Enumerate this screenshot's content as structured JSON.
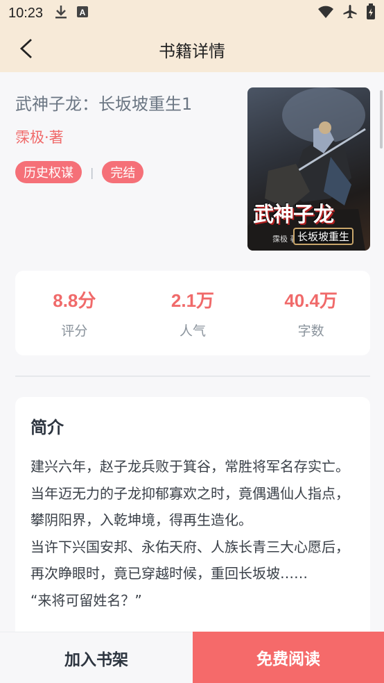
{
  "status_bar": {
    "time": "10:23",
    "icons": [
      "download-icon",
      "a-icon",
      "wifi-icon",
      "airplane-icon",
      "battery-icon"
    ]
  },
  "nav": {
    "title": "书籍详情"
  },
  "book": {
    "title": "武神子龙：长坂坡重生1",
    "author": "霂极·著",
    "tags": [
      "历史权谋",
      "完结"
    ],
    "tag_separator": "|",
    "cover": {
      "title_text": "武神子龙",
      "subtitle_text": "长坂坡重生",
      "author_text": "霂极 著"
    }
  },
  "stats": [
    {
      "value": "8.8分",
      "label": "评分"
    },
    {
      "value": "2.1万",
      "label": "人气"
    },
    {
      "value": "40.4万",
      "label": "字数"
    }
  ],
  "intro": {
    "heading": "简介",
    "text": "建兴六年，赵子龙兵败于箕谷，常胜将军名存实亡。\n当年迈无力的子龙抑郁寡欢之时，竟偶遇仙人指点，攀阴阳界，入乾坤境，得再生造化。\n当许下兴国安邦、永佑天府、人族长青三大心愿后，再次睁眼时，竟已穿越时候，重回长坂坡……\n“来将可留姓名？”"
  },
  "bottom": {
    "add_shelf": "加入书架",
    "read_free": "免费阅读"
  },
  "colors": {
    "accent": "#f56a6a",
    "header_bg": "#f7ead8"
  }
}
